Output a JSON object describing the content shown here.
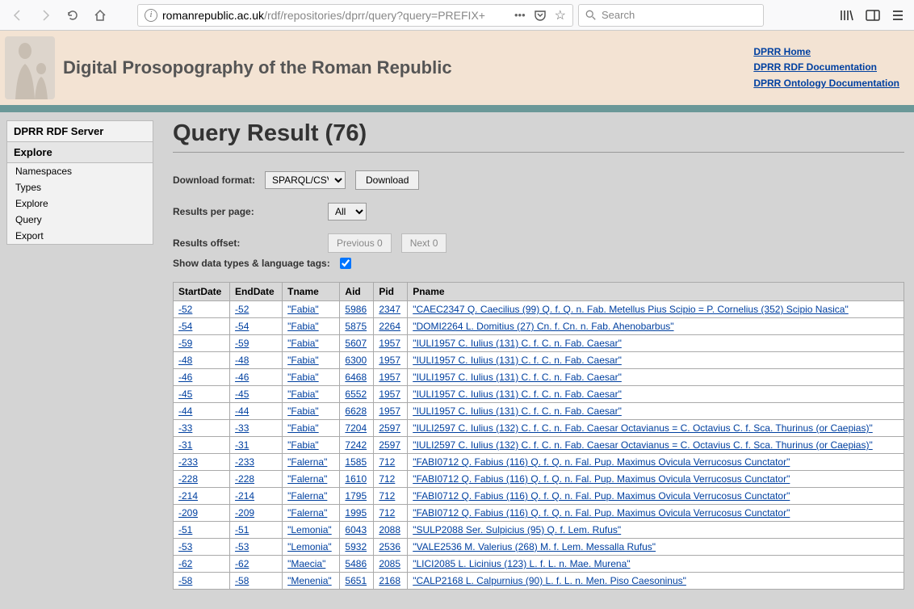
{
  "browser": {
    "url_prefix": "romanrepublic.ac.uk",
    "url_path": "/rdf/repositories/dprr/query?query=PREFIX+",
    "search_placeholder": "Search"
  },
  "header": {
    "site_title": "Digital Prosopography of the Roman Republic",
    "links": [
      {
        "label": "DPRR Home"
      },
      {
        "label": "DPRR RDF Documentation"
      },
      {
        "label": "DPRR Ontology Documentation"
      }
    ]
  },
  "sidebar": {
    "title": "DPRR RDF Server",
    "section": "Explore",
    "items": [
      "Namespaces",
      "Types",
      "Explore",
      "Query",
      "Export"
    ]
  },
  "content": {
    "title": "Query Result (76)",
    "download_label": "Download format:",
    "download_format": "SPARQL/CSV",
    "download_button": "Download",
    "rpp_label": "Results per page:",
    "rpp_value": "All",
    "offset_label": "Results offset:",
    "prev_label": "Previous 0",
    "next_label": "Next 0",
    "showtypes_label": "Show data types & language tags:",
    "showtypes_checked": true
  },
  "table": {
    "columns": [
      "StartDate",
      "EndDate",
      "Tname",
      "Aid",
      "Pid",
      "Pname"
    ],
    "rows": [
      {
        "StartDate": "-52",
        "EndDate": "-52",
        "Tname": "\"Fabia\"",
        "Aid": "5986",
        "Pid": "2347",
        "Pname": "\"CAEC2347 Q. Caecilius (99) Q. f. Q. n. Fab. Metellus Pius Scipio = P. Cornelius (352) Scipio Nasica\""
      },
      {
        "StartDate": "-54",
        "EndDate": "-54",
        "Tname": "\"Fabia\"",
        "Aid": "5875",
        "Pid": "2264",
        "Pname": "\"DOMI2264 L. Domitius (27) Cn. f. Cn. n. Fab. Ahenobarbus\""
      },
      {
        "StartDate": "-59",
        "EndDate": "-59",
        "Tname": "\"Fabia\"",
        "Aid": "5607",
        "Pid": "1957",
        "Pname": "\"IULI1957 C. Iulius (131) C. f. C. n. Fab. Caesar\""
      },
      {
        "StartDate": "-48",
        "EndDate": "-48",
        "Tname": "\"Fabia\"",
        "Aid": "6300",
        "Pid": "1957",
        "Pname": "\"IULI1957 C. Iulius (131) C. f. C. n. Fab. Caesar\""
      },
      {
        "StartDate": "-46",
        "EndDate": "-46",
        "Tname": "\"Fabia\"",
        "Aid": "6468",
        "Pid": "1957",
        "Pname": "\"IULI1957 C. Iulius (131) C. f. C. n. Fab. Caesar\""
      },
      {
        "StartDate": "-45",
        "EndDate": "-45",
        "Tname": "\"Fabia\"",
        "Aid": "6552",
        "Pid": "1957",
        "Pname": "\"IULI1957 C. Iulius (131) C. f. C. n. Fab. Caesar\""
      },
      {
        "StartDate": "-44",
        "EndDate": "-44",
        "Tname": "\"Fabia\"",
        "Aid": "6628",
        "Pid": "1957",
        "Pname": "\"IULI1957 C. Iulius (131) C. f. C. n. Fab. Caesar\""
      },
      {
        "StartDate": "-33",
        "EndDate": "-33",
        "Tname": "\"Fabia\"",
        "Aid": "7204",
        "Pid": "2597",
        "Pname": "\"IULI2597 C. Iulius (132) C. f. C. n. Fab. Caesar Octavianus = C. Octavius C. f. Sca. Thurinus (or Caepias)\""
      },
      {
        "StartDate": "-31",
        "EndDate": "-31",
        "Tname": "\"Fabia\"",
        "Aid": "7242",
        "Pid": "2597",
        "Pname": "\"IULI2597 C. Iulius (132) C. f. C. n. Fab. Caesar Octavianus = C. Octavius C. f. Sca. Thurinus (or Caepias)\""
      },
      {
        "StartDate": "-233",
        "EndDate": "-233",
        "Tname": "\"Falerna\"",
        "Aid": "1585",
        "Pid": "712",
        "Pname": "\"FABI0712 Q. Fabius (116) Q. f. Q. n. Fal. Pup. Maximus Ovicula Verrucosus Cunctator\""
      },
      {
        "StartDate": "-228",
        "EndDate": "-228",
        "Tname": "\"Falerna\"",
        "Aid": "1610",
        "Pid": "712",
        "Pname": "\"FABI0712 Q. Fabius (116) Q. f. Q. n. Fal. Pup. Maximus Ovicula Verrucosus Cunctator\""
      },
      {
        "StartDate": "-214",
        "EndDate": "-214",
        "Tname": "\"Falerna\"",
        "Aid": "1795",
        "Pid": "712",
        "Pname": "\"FABI0712 Q. Fabius (116) Q. f. Q. n. Fal. Pup. Maximus Ovicula Verrucosus Cunctator\""
      },
      {
        "StartDate": "-209",
        "EndDate": "-209",
        "Tname": "\"Falerna\"",
        "Aid": "1995",
        "Pid": "712",
        "Pname": "\"FABI0712 Q. Fabius (116) Q. f. Q. n. Fal. Pup. Maximus Ovicula Verrucosus Cunctator\""
      },
      {
        "StartDate": "-51",
        "EndDate": "-51",
        "Tname": "\"Lemonia\"",
        "Aid": "6043",
        "Pid": "2088",
        "Pname": "\"SULP2088 Ser. Sulpicius (95) Q. f. Lem. Rufus\""
      },
      {
        "StartDate": "-53",
        "EndDate": "-53",
        "Tname": "\"Lemonia\"",
        "Aid": "5932",
        "Pid": "2536",
        "Pname": "\"VALE2536 M. Valerius (268) M. f. Lem. Messalla Rufus\""
      },
      {
        "StartDate": "-62",
        "EndDate": "-62",
        "Tname": "\"Maecia\"",
        "Aid": "5486",
        "Pid": "2085",
        "Pname": "\"LICI2085 L. Licinius (123) L. f. L. n. Mae. Murena\""
      },
      {
        "StartDate": "-58",
        "EndDate": "-58",
        "Tname": "\"Menenia\"",
        "Aid": "5651",
        "Pid": "2168",
        "Pname": "\"CALP2168 L. Calpurnius (90) L. f. L. n. Men. Piso Caesoninus\""
      }
    ]
  }
}
